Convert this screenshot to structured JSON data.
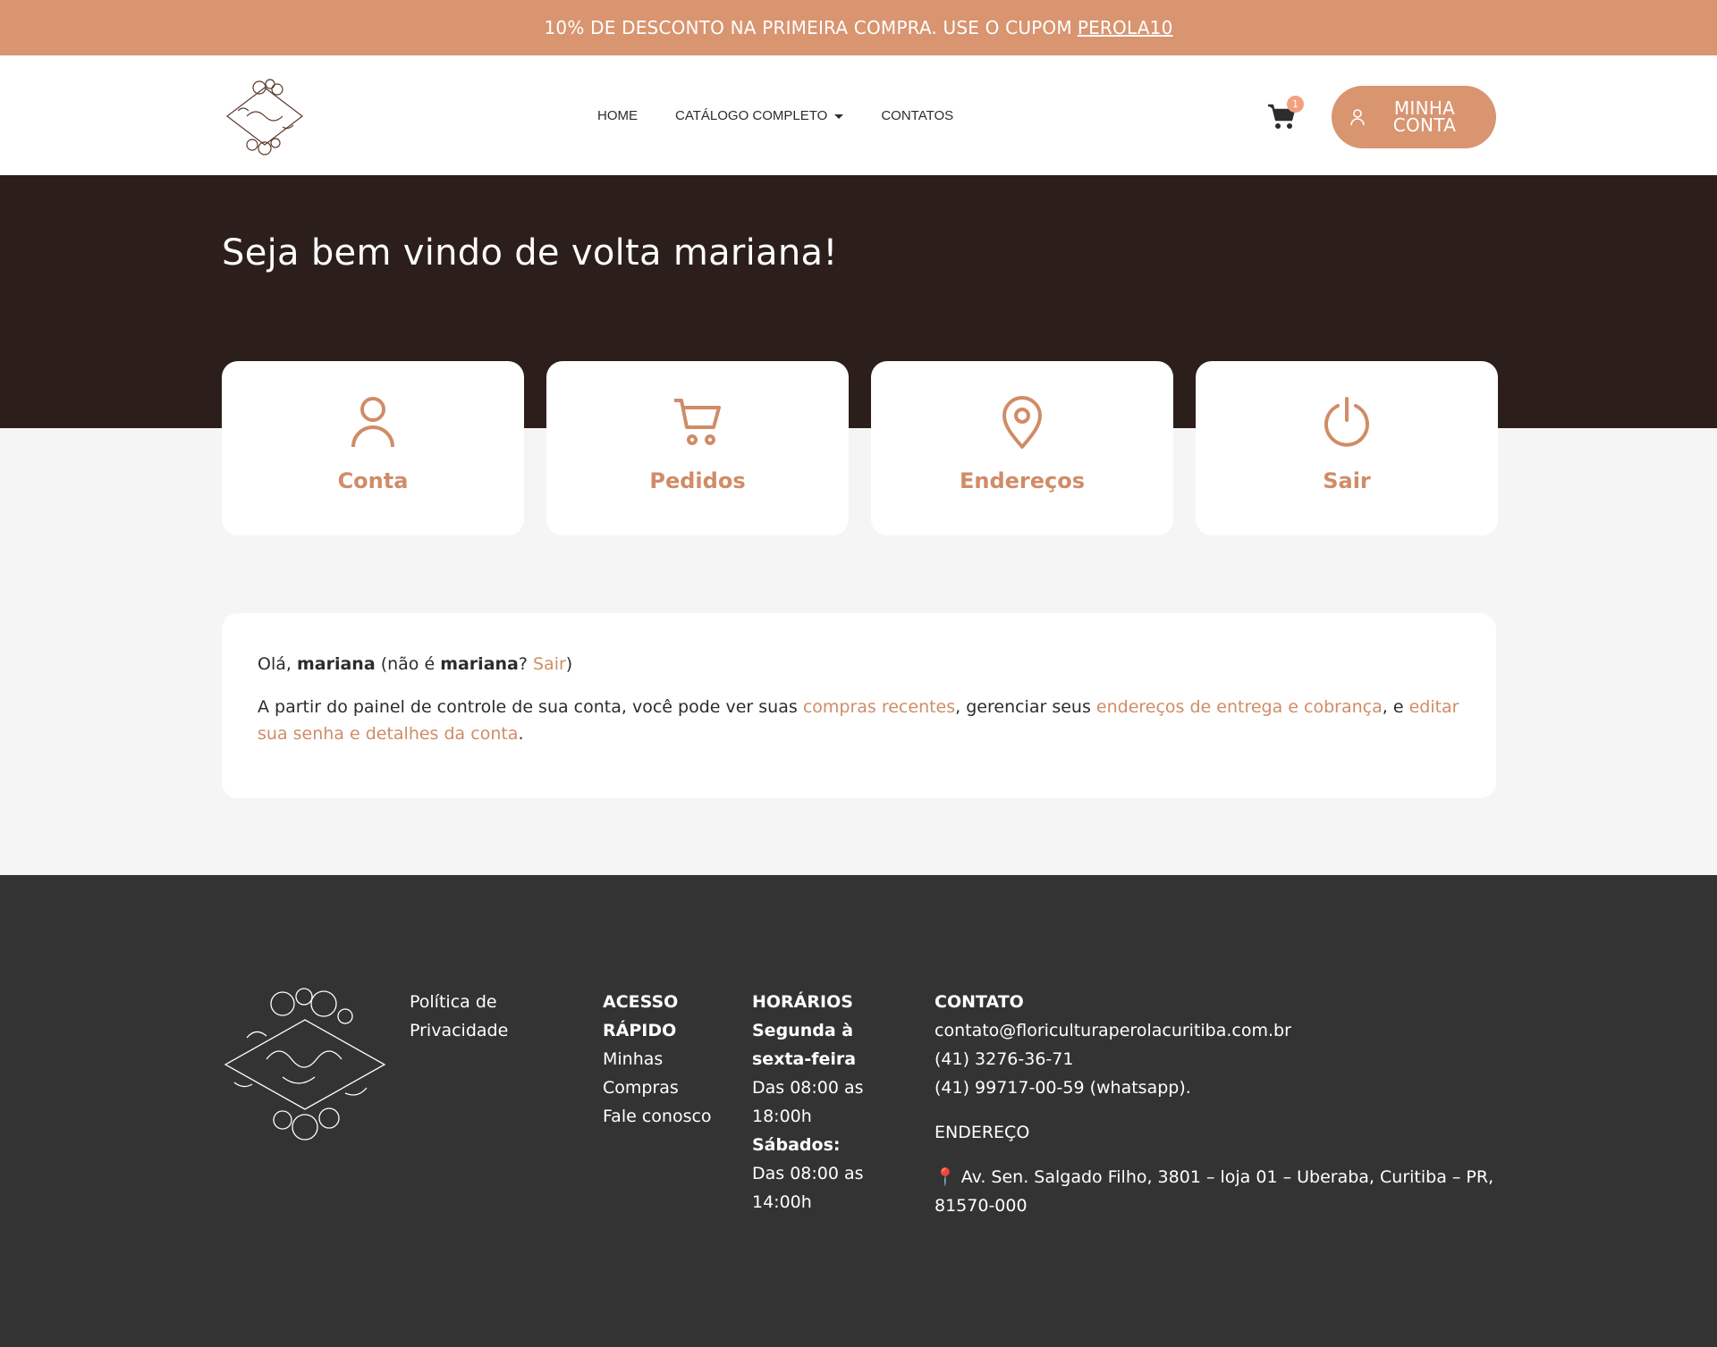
{
  "promo": {
    "text": "10% DE DESCONTO NA PRIMEIRA COMPRA. USE O CUPOM",
    "code": "PEROLA10"
  },
  "header": {
    "nav": [
      "HOME",
      "CATÁLOGO COMPLETO",
      "CONTATOS"
    ],
    "cart_count": "1",
    "account_line1": "MINHA",
    "account_line2": "CONTA"
  },
  "hero": {
    "title": "Seja bem vindo de volta mariana!"
  },
  "cards": [
    "Conta",
    "Pedidos",
    "Endereços",
    "Sair"
  ],
  "panel": {
    "hello": "Olá,",
    "user": "mariana",
    "not_prefix": "(não é",
    "not_user": "mariana",
    "q": "?",
    "logout": "Sair",
    "close": ")",
    "line2_a": "A partir do painel de controle de sua conta, você pode ver suas",
    "link_orders": "compras recentes",
    "line2_b": ", gerenciar seus",
    "link_addresses": "endereços de entrega e cobrança",
    "line2_c": ", e",
    "link_account": "editar sua senha e detalhes da conta",
    "line2_end": "."
  },
  "footer": {
    "privacy": "Política de Privacidade",
    "quick_title": "ACESSO RÁPIDO",
    "quick_links": [
      "Minhas Compras",
      "Fale conosco"
    ],
    "hours_title": "HORÁRIOS",
    "weekday_label": "Segunda à sexta-feira",
    "weekday_hours": "Das 08:00 as 18:00h",
    "saturday_label": "Sábados:",
    "saturday_hours": "Das 08:00 as 14:00h",
    "contact_title": "CONTATO",
    "email": "contato@floriculturaperolacuritiba.com.br",
    "phone1": "(41) 3276-36-71",
    "phone2": "(41) 99717-00-59 (whatsapp).",
    "address_title": "ENDEREÇO",
    "address": "📍 Av. Sen. Salgado Filho, 3801 – loja 01 – Uberaba, Curitiba – PR, 81570-000"
  },
  "colors": {
    "accent": "#d89570",
    "hero_bg": "#2c1f1b",
    "footer_bg": "#333333"
  },
  "icons": {
    "card_icons": [
      "user-icon",
      "cart-icon",
      "map-pin-icon",
      "power-icon"
    ]
  }
}
